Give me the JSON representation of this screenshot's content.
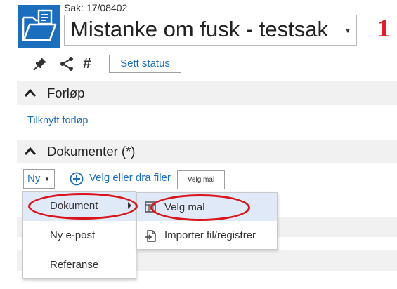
{
  "header": {
    "case_number": "Sak: 17/08402",
    "title": "Mistanke om fusk - testsak",
    "annotation_number": "1"
  },
  "toolbar": {
    "icons": [
      "pin-icon",
      "share-icon",
      "hash-icon"
    ],
    "hash_glyph": "#",
    "set_status_label": "Sett status"
  },
  "sections": {
    "forlop": {
      "title": "Forløp",
      "link": "Tilknytt forløp"
    },
    "dokumenter": {
      "title": "Dokumenter (*)"
    }
  },
  "documents_toolbar": {
    "new_button_label": "Ny",
    "add_link": "Velg eller dra filer",
    "tooltip": "Velg mal"
  },
  "new_menu": {
    "items": [
      "Dokument",
      "Ny e-post",
      "Referanse"
    ],
    "highlighted": "Dokument"
  },
  "dokument_submenu": {
    "items": [
      "Velg mal",
      "Importer fil/registrer"
    ],
    "highlighted": "Velg mal"
  },
  "colors": {
    "accent": "#1b6ebd",
    "annotation_red": "#d9141b",
    "section_bg": "#f1f1f1",
    "highlight": "#dfe9f7"
  }
}
